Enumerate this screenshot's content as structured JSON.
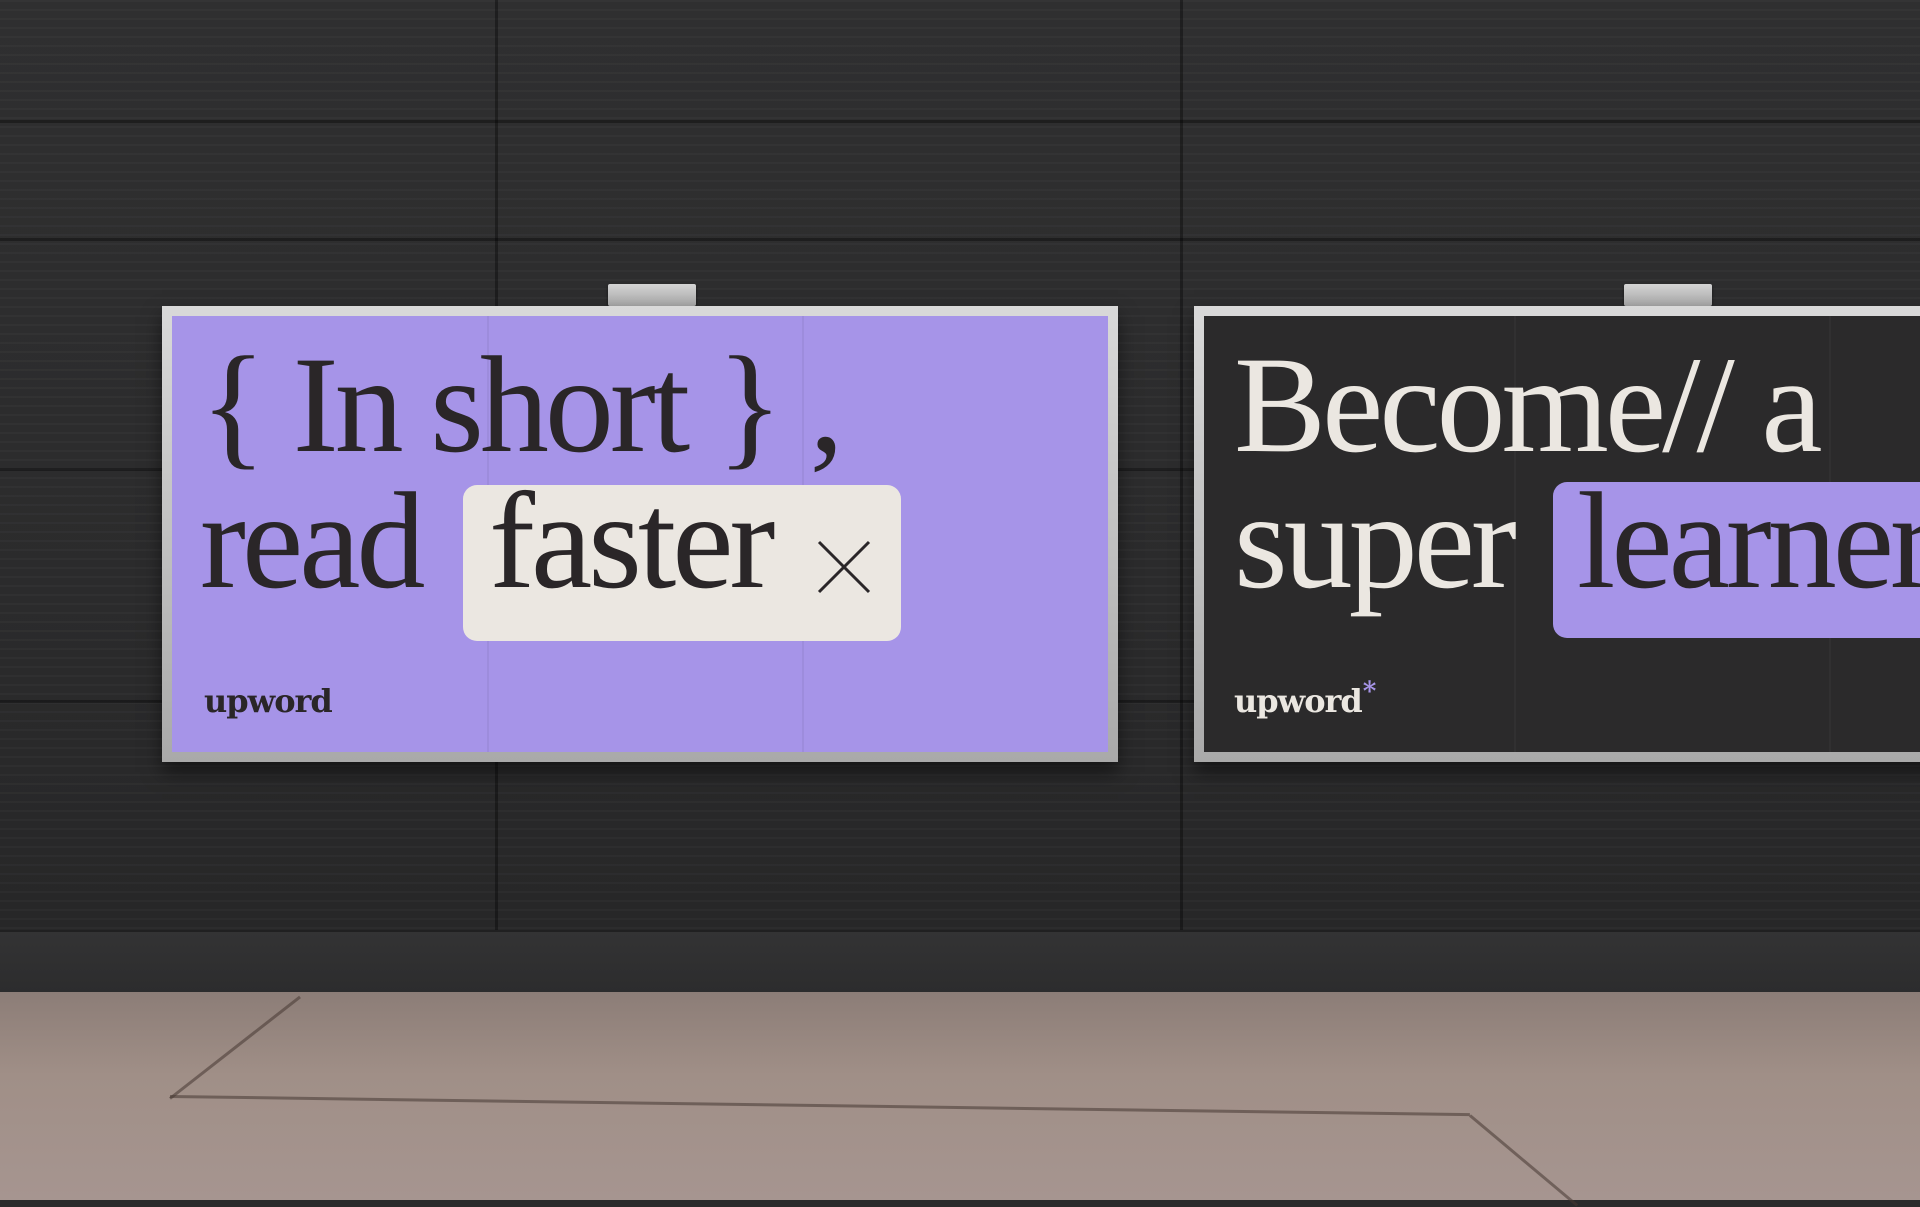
{
  "colors": {
    "poster_purple": "#a694e8",
    "poster_dark": "#2b2a2b",
    "text_dark": "#2a2628",
    "text_light": "#ebe7e1",
    "chip_cream": "#ebe7e1",
    "accent_star": "#a694e8"
  },
  "billboards": [
    {
      "line1": "{ In short } ,",
      "line2_start": "read",
      "highlight": "faster",
      "icon": "close-icon",
      "logo": "upword",
      "logo_star": "*"
    },
    {
      "line1": "Become// a",
      "line2_start": "super",
      "highlight": "learner",
      "logo": "upword",
      "logo_star": "*"
    }
  ]
}
